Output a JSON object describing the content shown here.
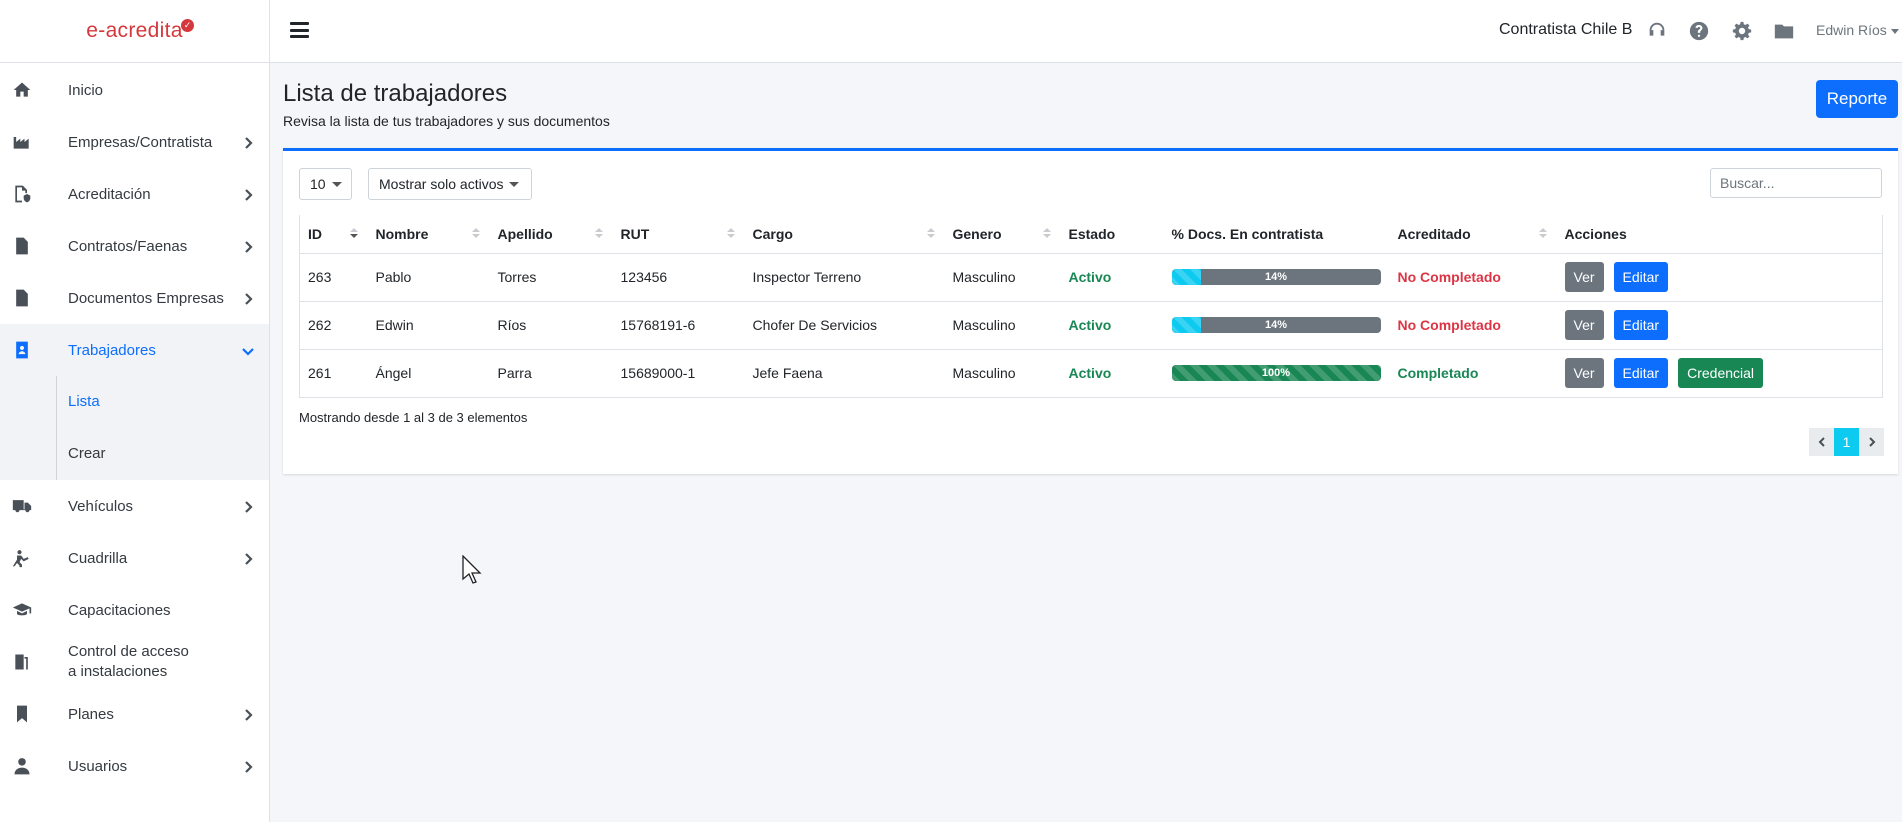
{
  "brand": {
    "name": "e-acredita",
    "check": "✓"
  },
  "sidebar": {
    "items": [
      {
        "label": "Inicio",
        "icon": "home-icon"
      },
      {
        "label": "Empresas/Contratista",
        "icon": "industry-icon"
      },
      {
        "label": "Acreditación",
        "icon": "file-shield-icon"
      },
      {
        "label": "Contratos/Faenas",
        "icon": "file-contract-icon"
      },
      {
        "label": "Documentos Empresas",
        "icon": "file-icon"
      },
      {
        "label": "Trabajadores",
        "icon": "id-badge-icon"
      },
      {
        "label": "Vehículos",
        "icon": "truck-icon"
      },
      {
        "label": "Cuadrilla",
        "icon": "worker-icon"
      },
      {
        "label": "Capacitaciones",
        "icon": "graduation-cap-icon"
      },
      {
        "label": "Control de acceso",
        "label2": "a instalaciones",
        "icon": "door-icon"
      },
      {
        "label": "Planes",
        "icon": "bookmark-icon"
      },
      {
        "label": "Usuarios",
        "icon": "user-icon"
      }
    ],
    "submenu": [
      {
        "label": "Lista"
      },
      {
        "label": "Crear"
      }
    ]
  },
  "header": {
    "company": "Contratista Chile B",
    "user": "Edwin Ríos"
  },
  "page": {
    "title": "Lista de trabajadores",
    "subtitle": "Revisa la lista de tus trabajadores y sus documentos",
    "report_button": "Reporte"
  },
  "table": {
    "page_size": "10",
    "filter": "Mostrar solo activos",
    "search_placeholder": "Buscar...",
    "columns": [
      "ID",
      "Nombre",
      "Apellido",
      "RUT",
      "Cargo",
      "Genero",
      "Estado",
      "% Docs. En contratista",
      "Acreditado",
      "Acciones"
    ],
    "rows": [
      {
        "id": "263",
        "nombre": "Pablo",
        "apellido": "Torres",
        "rut": "123456",
        "cargo": "Inspector Terreno",
        "genero": "Masculino",
        "estado": "Activo",
        "docs_pct": 14,
        "docs_label": "14%",
        "acreditado": "No Completado"
      },
      {
        "id": "262",
        "nombre": "Edwin",
        "apellido": "Ríos",
        "rut": "15768191-6",
        "cargo": "Chofer De Servicios",
        "genero": "Masculino",
        "estado": "Activo",
        "docs_pct": 14,
        "docs_label": "14%",
        "acreditado": "No Completado"
      },
      {
        "id": "261",
        "nombre": "Ángel",
        "apellido": "Parra",
        "rut": "15689000-1",
        "cargo": "Jefe Faena",
        "genero": "Masculino",
        "estado": "Activo",
        "docs_pct": 100,
        "docs_label": "100%",
        "acreditado": "Completado"
      }
    ],
    "actions": {
      "ver": "Ver",
      "editar": "Editar",
      "credencial": "Credencial"
    },
    "info": "Mostrando desde 1 al 3 de 3 elementos",
    "current_page": "1"
  },
  "colors": {
    "primary": "#0d6efd",
    "success": "#198754",
    "danger": "#dc3545",
    "info": "#0dcaf0",
    "secondary": "#6c757d",
    "brand": "#d5383c"
  }
}
